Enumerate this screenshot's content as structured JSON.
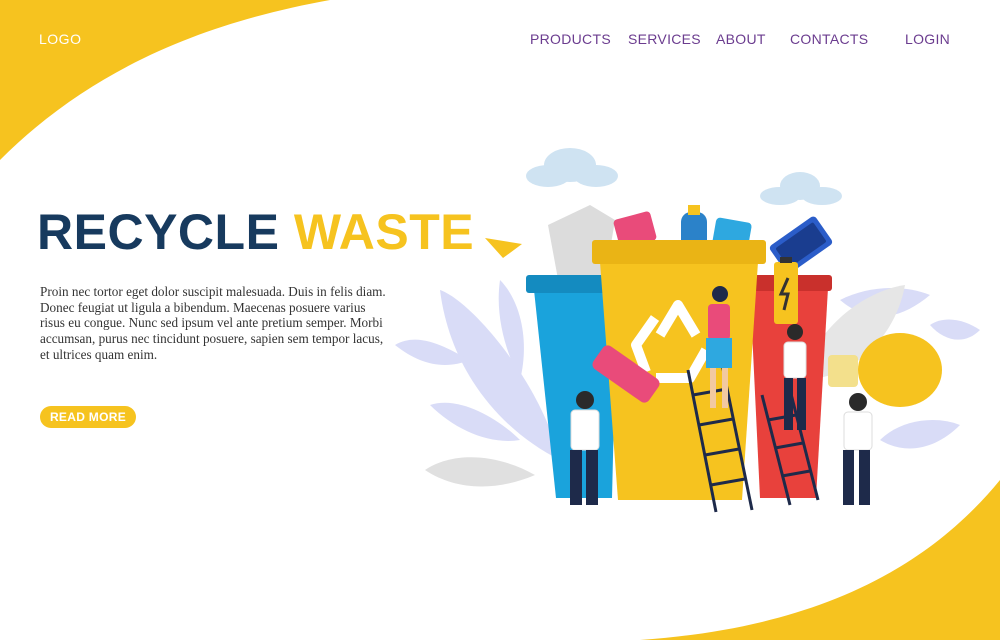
{
  "header": {
    "logo": "LOGO",
    "nav": {
      "products": "PRODUCTS",
      "services": "SERVICES",
      "about": "ABOUT",
      "contacts": "CONTACTS",
      "login": "LOGIN"
    }
  },
  "hero": {
    "title_part1": "RECYCLE",
    "title_part2": "WASTE",
    "description": "Proin nec tortor eget dolor suscipit malesuada. Duis in felis diam. Donec feugiat ut ligula a bibendum. Maecenas posuere varius risus eu congue. Nunc sed ipsum vel ante pretium semper. Morbi accumsan, purus nec tincidunt posuere, sapien sem tempor lacus, et ultrices quam enim.",
    "cta_label": "READ MORE"
  },
  "colors": {
    "accent_yellow": "#f6c31f",
    "title_navy": "#173a5e",
    "nav_purple": "#6b3c8f",
    "bin_blue": "#1aa3dc",
    "bin_yellow": "#f6c31f",
    "bin_red": "#e8413c"
  },
  "icons": [
    "recycle-icon",
    "paper-plane-icon",
    "cloud-icon",
    "light-bulb-icon",
    "battery-icon",
    "phone-icon",
    "bottle-icon"
  ]
}
